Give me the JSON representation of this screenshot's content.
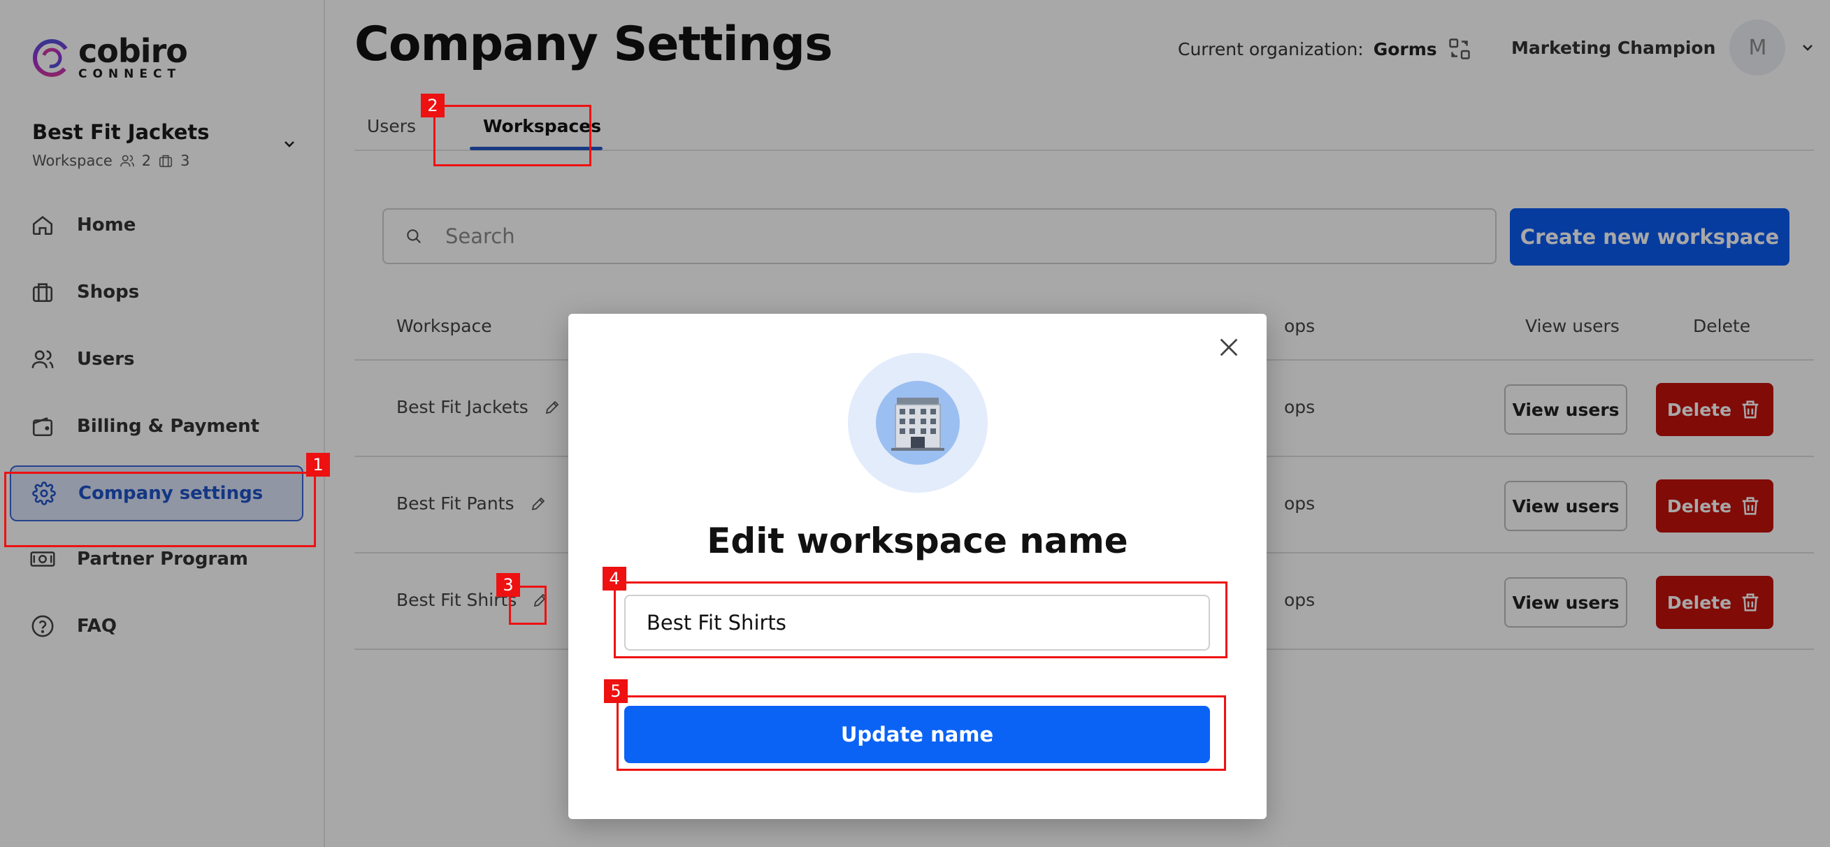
{
  "brand": {
    "name": "cobiro",
    "sub": "CONNECT"
  },
  "workspace_switch": {
    "name": "Best Fit Jackets",
    "type": "Workspace",
    "users_count": "2",
    "shops_count": "3"
  },
  "sidebar": {
    "items": [
      {
        "label": "Home",
        "icon": "home-icon"
      },
      {
        "label": "Shops",
        "icon": "shopping-bag-icon"
      },
      {
        "label": "Users",
        "icon": "users-icon"
      },
      {
        "label": "Billing & Payment",
        "icon": "wallet-icon"
      },
      {
        "label": "Company settings",
        "icon": "gear-icon",
        "active": true
      },
      {
        "label": "Partner Program",
        "icon": "money-icon"
      },
      {
        "label": "FAQ",
        "icon": "help-icon"
      }
    ]
  },
  "header": {
    "title": "Company Settings",
    "org_label": "Current organization:",
    "org_name": "Gorms",
    "user_name": "Marketing Champion",
    "avatar_initial": "M"
  },
  "tabs": [
    {
      "label": "Users",
      "active": false
    },
    {
      "label": "Workspaces",
      "active": true
    }
  ],
  "search": {
    "placeholder": "Search",
    "value": ""
  },
  "create_button": "Create new workspace",
  "table": {
    "columns": [
      "Workspace",
      "Shops",
      "View users",
      "Delete"
    ],
    "columns_visible": {
      "workspace": "Workspace",
      "shops": "ops",
      "view_users": "View users",
      "delete": "Delete"
    },
    "rows": [
      {
        "name": "Best Fit Jackets",
        "shops": "ops",
        "view_label": "View users",
        "delete_label": "Delete"
      },
      {
        "name": "Best Fit Pants",
        "shops": "ops",
        "view_label": "View users",
        "delete_label": "Delete"
      },
      {
        "name": "Best Fit Shirts",
        "shops": "ops",
        "view_label": "View users",
        "delete_label": "Delete"
      }
    ]
  },
  "modal": {
    "title": "Edit workspace name",
    "input_value": "Best Fit Shirts",
    "submit_label": "Update name",
    "icon": "office-building-icon"
  },
  "annotations": [
    "1",
    "2",
    "3",
    "4",
    "5"
  ],
  "colors": {
    "primary": "#0b5bf2",
    "danger": "#c4120b",
    "annotation": "#ee1111",
    "active_nav": "#1f52c8"
  }
}
